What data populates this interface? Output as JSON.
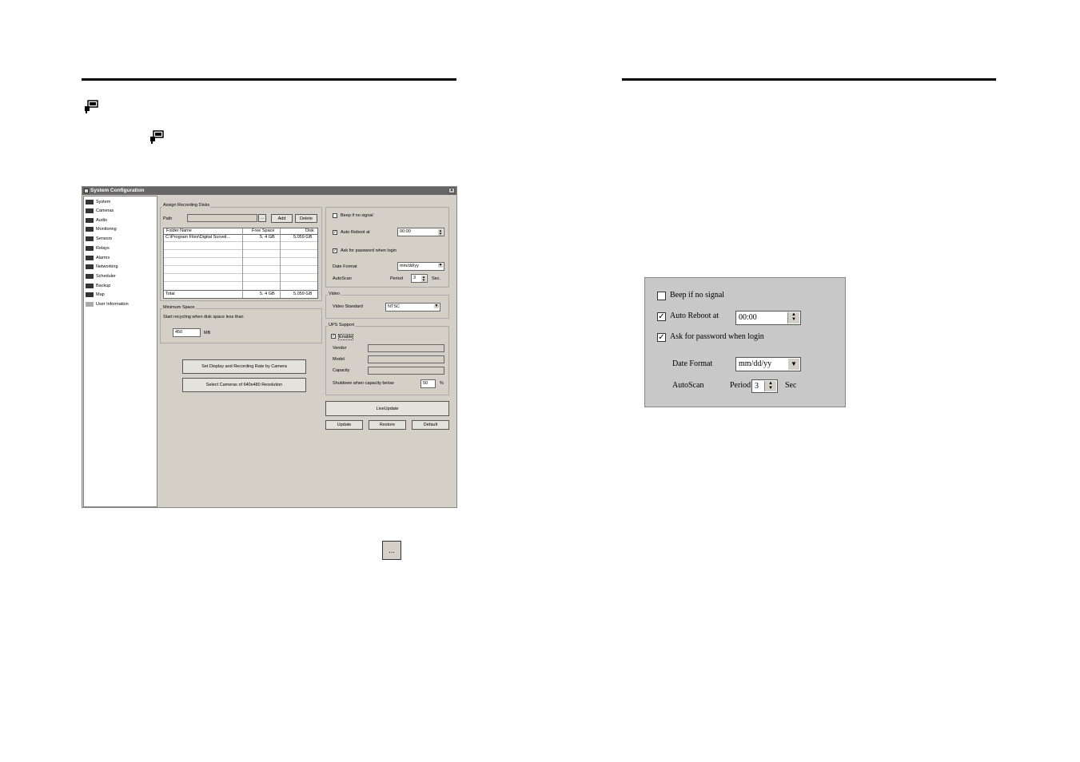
{
  "window": {
    "title": "System Configuration",
    "close_label": "×"
  },
  "sidebar": {
    "items": [
      {
        "label": "System",
        "icon": "system-icon"
      },
      {
        "label": "Cameras",
        "icon": "camera-icon"
      },
      {
        "label": "Audio",
        "icon": "audio-icon"
      },
      {
        "label": "Monitoring",
        "icon": "monitor-icon"
      },
      {
        "label": "Sensors",
        "icon": "sensor-icon"
      },
      {
        "label": "Relays",
        "icon": "relay-icon"
      },
      {
        "label": "Alarms",
        "icon": "alarm-icon"
      },
      {
        "label": "Networking",
        "icon": "network-icon"
      },
      {
        "label": "Scheduler",
        "icon": "scheduler-icon"
      },
      {
        "label": "Backup",
        "icon": "backup-icon"
      },
      {
        "label": "Map",
        "icon": "map-icon"
      },
      {
        "label": "User Information",
        "icon": "user-icon"
      }
    ]
  },
  "recording_disks": {
    "group_label": "Assign Recording Disks",
    "path_label": "Path",
    "path_value": "",
    "browse_label": "...",
    "add_label": "Add",
    "delete_label": "Delete",
    "columns": [
      "Folder Name",
      "Free Space",
      "Disk"
    ],
    "rows": [
      {
        "folder": "C:\\Program Files\\Digital Surveil...",
        "free": "5. 4 GB",
        "disk": "5.059 GB"
      }
    ],
    "total_label": "Total",
    "total_free": "5. 4 GB",
    "total_disk": "5.059 GB"
  },
  "minimum_space": {
    "group_label": "Minimum Space",
    "description": "Start recycling when disk space less than",
    "value": "450",
    "unit": "MB"
  },
  "actions": {
    "set_display_label": "Set Display and Recording Rate by Camera",
    "select_cameras_label": "Select Cameras of 640x480 Resolution"
  },
  "general": {
    "beep_label": "Beep if no signal",
    "beep_checked": "",
    "auto_reboot_label": "Auto Reboot at",
    "auto_reboot_checked": "✓",
    "auto_reboot_time": "00:00",
    "ask_password_label": "Ask for password when login",
    "ask_password_checked": "✓",
    "date_format_label": "Date Format",
    "date_format_value": "mm/dd/yy",
    "autoscan_label": "AutoScan",
    "period_label": "Period",
    "period_value": "3",
    "sec_label": "Sec."
  },
  "video": {
    "group_label": "Video",
    "standard_label": "Video Standard",
    "standard_value": "NTSC"
  },
  "ups": {
    "group_label": "UPS Support",
    "enable_label": "Enable",
    "enable_checked": "✓",
    "vendor_label": "Vendor",
    "model_label": "Model",
    "capacity_label": "Capacity",
    "shutdown_label": "Shutdown when capacity below",
    "shutdown_value": "50",
    "percent_label": "%"
  },
  "buttons": {
    "liveupdate_label": "LiveUpdate",
    "update_label": "Update",
    "restore_label": "Restore",
    "default_label": "Default"
  },
  "standalone_browse": {
    "label": "..."
  },
  "zoomed_panel": {
    "beep_label": "Beep if no signal",
    "beep_checked": "",
    "auto_reboot_label": "Auto Reboot at",
    "auto_reboot_checked": "✓",
    "auto_reboot_time": "00:00",
    "ask_password_label": "Ask for password when login",
    "ask_password_checked": "✓",
    "date_format_label": "Date Format",
    "date_format_value": "mm/dd/yy",
    "autoscan_label": "AutoScan",
    "period_label": "Period",
    "period_value": "3",
    "sec_label": "Sec"
  }
}
